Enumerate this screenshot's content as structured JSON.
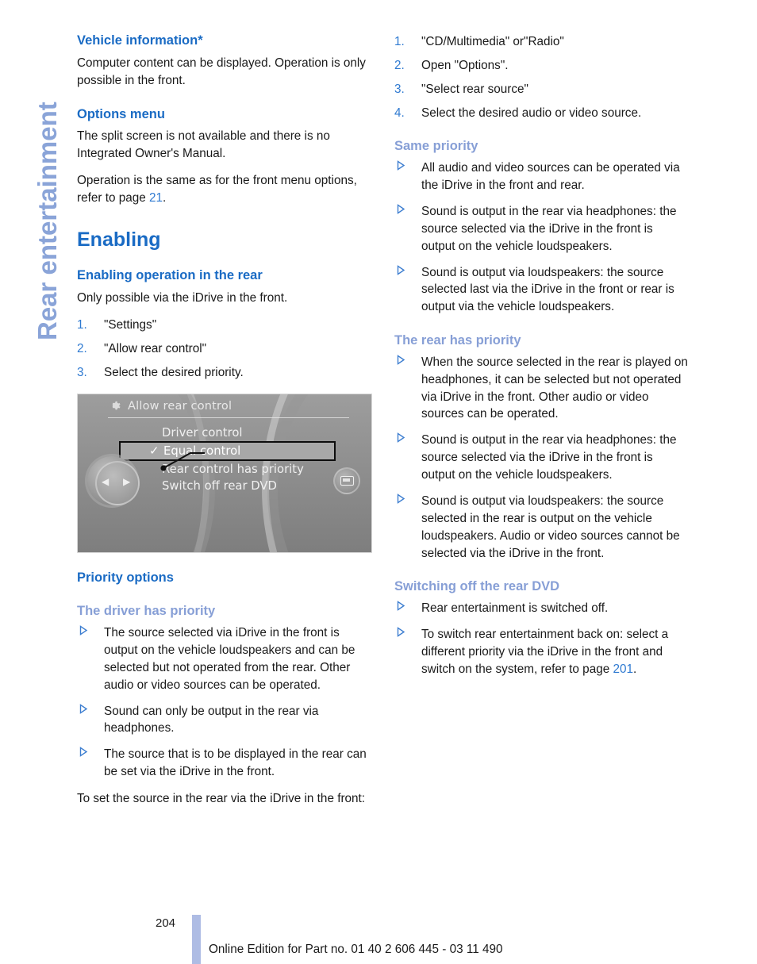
{
  "chapter_tab": {
    "label": "Rear entertainment"
  },
  "colors": {
    "heading_strong_blue": "#1a6bc4",
    "heading_light_blue": "#879fd6",
    "chapter_tab_blue": "#8aa4d8",
    "link_blue": "#2f7ad1",
    "footer_bar": "#aebce4"
  },
  "left_column": {
    "vehicle_information": {
      "heading": "Vehicle information*",
      "paragraph": "Computer content can be displayed. Operation is only possible in the front."
    },
    "options_menu": {
      "heading": "Options menu",
      "paragraph_1": "The split screen is not available and there is no Integrated Owner's Manual.",
      "paragraph_2_before": "Operation is the same as for the front menu options, refer to page ",
      "paragraph_2_ref": "21",
      "paragraph_2_after": "."
    },
    "enabling": {
      "title": "Enabling",
      "subheading": "Enabling operation in the rear",
      "paragraph": "Only possible via the iDrive in the front.",
      "steps": [
        {
          "num": "1.",
          "text": "\"Settings\""
        },
        {
          "num": "2.",
          "text": "\"Allow rear control\""
        },
        {
          "num": "3.",
          "text": "Select the desired priority."
        }
      ]
    },
    "idrive_figure": {
      "title": "Allow rear control",
      "gear_icon": "gear-icon",
      "monitor_icon": "monitor-icon",
      "menu_items": [
        {
          "label": "Driver control",
          "selected": false,
          "check": ""
        },
        {
          "label": "Equal control",
          "selected": true,
          "check": "✓"
        },
        {
          "label": "Rear control has priority",
          "selected": false,
          "check": ""
        },
        {
          "label": "Switch off rear DVD",
          "selected": false,
          "check": ""
        }
      ]
    },
    "priority_options": {
      "heading": "Priority options",
      "driver_priority": {
        "heading": "The driver has priority",
        "bullets": [
          "The source selected via iDrive in the front is output on the vehicle loudspeakers and can be selected but not operated from the rear. Other audio or video sources can be operated.",
          "Sound can only be output in the rear via headphones.",
          "The source that is to be displayed in the rear can be set via the iDrive in the front."
        ],
        "closing_paragraph": "To set the source in the rear via the iDrive in the front:"
      }
    }
  },
  "right_column": {
    "source_steps": [
      {
        "num": "1.",
        "text": "\"CD/Multimedia\" or\"Radio\""
      },
      {
        "num": "2.",
        "text": "Open \"Options\"."
      },
      {
        "num": "3.",
        "text": "\"Select rear source\""
      },
      {
        "num": "4.",
        "text": "Select the desired audio or video source."
      }
    ],
    "same_priority": {
      "heading": "Same priority",
      "bullets": [
        "All audio and video sources can be operated via the iDrive in the front and rear.",
        "Sound is output in the rear via headphones: the source selected via the iDrive in the front is output on the vehicle loudspeakers.",
        "Sound is output via loudspeakers: the source selected last via the iDrive in the front or rear is output via the vehicle loudspeakers."
      ]
    },
    "rear_priority": {
      "heading": "The rear has priority",
      "bullets": [
        "When the source selected in the rear is played on headphones, it can be selected but not operated via iDrive in the front. Other audio or video sources can be operated.",
        "Sound is output in the rear via headphones: the source selected via the iDrive in the front is output on the vehicle loudspeakers.",
        "Sound is output via loudspeakers: the source selected in the rear is output on the vehicle loudspeakers. Audio or video sources cannot be selected via the iDrive in the front."
      ]
    },
    "switching_off": {
      "heading": "Switching off the rear DVD",
      "bullet_1": "Rear entertainment is switched off.",
      "bullet_2_before": "To switch rear entertainment back on: select a different priority via the iDrive in the front and switch on the system, refer to page ",
      "bullet_2_ref": "201",
      "bullet_2_after": "."
    }
  },
  "footer": {
    "page_number": "204",
    "edition_text": "Online Edition for Part no. 01 40 2 606 445 - 03 11 490"
  }
}
